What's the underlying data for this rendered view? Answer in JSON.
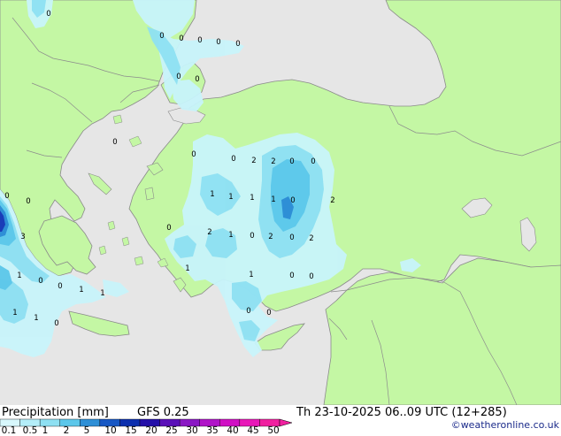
{
  "title": "Precipitation [mm]",
  "model": "GFS 0.25",
  "valid_time": "Th 23-10-2025 06..09 UTC (12+285)",
  "credit": "©weatheronline.co.uk",
  "colors": {
    "sea": "#e6e6e6",
    "land": "#c4f7a4",
    "coast": "#8a8a8a",
    "border": "#8c8c8c",
    "precip_light": "#c8f4fb",
    "precip_mid": "#8ee0f2",
    "precip_heavy": "#5cc7ea",
    "precip_max": "#2e8fd6"
  },
  "scale": {
    "labels": [
      "0.1",
      "0.5",
      "1",
      "2",
      "5",
      "10",
      "15",
      "20",
      "25",
      "30",
      "35",
      "40",
      "45",
      "50"
    ],
    "colors": [
      "#d8f8fc",
      "#b4eef9",
      "#8ee0f2",
      "#5cc7ea",
      "#2e8fd6",
      "#1858c4",
      "#0c2fae",
      "#2410a8",
      "#5a10b8",
      "#8a18c4",
      "#b014c8",
      "#d010c4",
      "#e818b8",
      "#f020a0"
    ]
  },
  "point_values": [
    {
      "text": "0"
    },
    {
      "text": "0"
    },
    {
      "text": "0"
    },
    {
      "text": "0"
    },
    {
      "text": "0"
    },
    {
      "text": "0"
    },
    {
      "text": "0"
    },
    {
      "text": "0"
    },
    {
      "text": "0"
    },
    {
      "text": "0"
    },
    {
      "text": "0"
    },
    {
      "text": "2"
    },
    {
      "text": "2"
    },
    {
      "text": "0"
    },
    {
      "text": "0"
    },
    {
      "text": "1"
    },
    {
      "text": "1"
    },
    {
      "text": "1"
    },
    {
      "text": "1"
    },
    {
      "text": "0"
    },
    {
      "text": "2"
    },
    {
      "text": "0"
    },
    {
      "text": "0"
    },
    {
      "text": "2"
    },
    {
      "text": "1"
    },
    {
      "text": "0"
    },
    {
      "text": "2"
    },
    {
      "text": "0"
    },
    {
      "text": "2"
    },
    {
      "text": "3"
    },
    {
      "text": "0"
    },
    {
      "text": "1"
    },
    {
      "text": "1"
    },
    {
      "text": "0"
    },
    {
      "text": "0"
    },
    {
      "text": "1"
    },
    {
      "text": "0"
    },
    {
      "text": "0"
    },
    {
      "text": "1"
    },
    {
      "text": "1"
    },
    {
      "text": "1"
    },
    {
      "text": "1"
    },
    {
      "text": "0"
    },
    {
      "text": "0"
    },
    {
      "text": "0"
    }
  ]
}
